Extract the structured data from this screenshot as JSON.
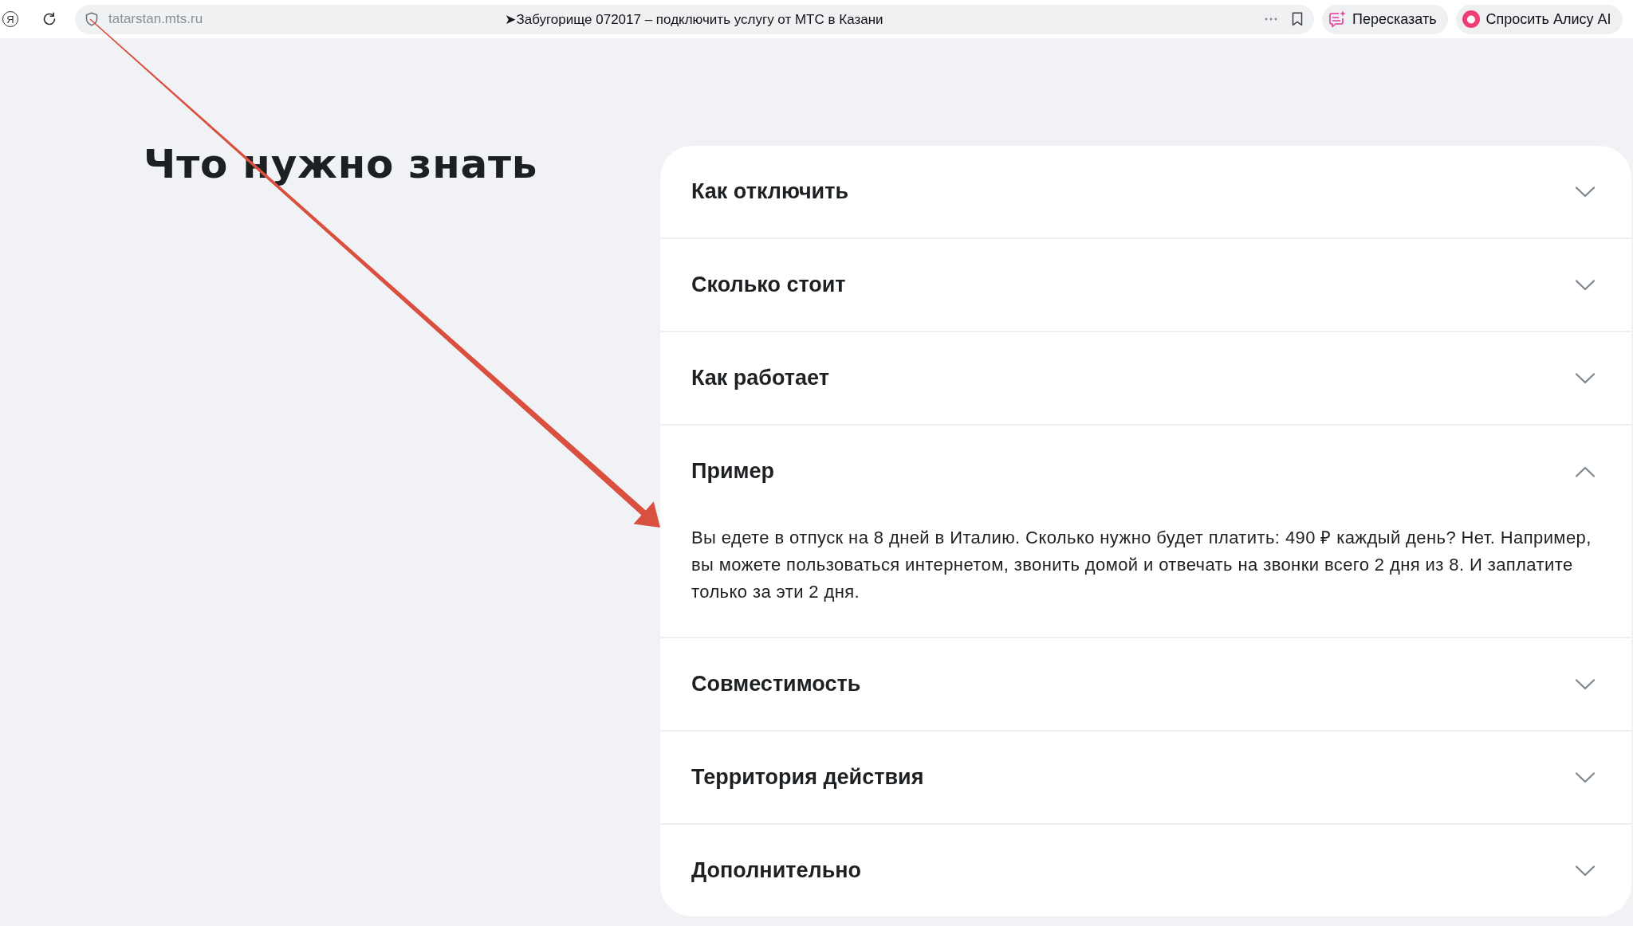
{
  "browser": {
    "logo": "Я",
    "address": "tatarstan.mts.ru",
    "page_title": "➤Забугорище 072017 – подключить услугу от МТС в Казани",
    "buttons": [
      {
        "label": "Пересказать",
        "kind": "retell"
      },
      {
        "label": "Спросить Алису AI",
        "kind": "alice"
      }
    ]
  },
  "section": {
    "heading": "Что нужно знать",
    "faq": [
      {
        "title": "Как отключить",
        "expanded": false
      },
      {
        "title": "Сколько стоит",
        "expanded": false
      },
      {
        "title": "Как работает",
        "expanded": false
      },
      {
        "title": "Пример",
        "expanded": true,
        "body": "Вы едете в отпуск на 8 дней в Италию. Сколько нужно будет платить: 490 ₽ каждый день? Нет. Например, вы можете пользоваться интернетом, звонить домой и отвечать на звонки всего 2 дня из 8. И заплатите только за эти 2 дня."
      },
      {
        "title": "Совместимость",
        "expanded": false
      },
      {
        "title": "Территория действия",
        "expanded": false
      },
      {
        "title": "Дополнительно",
        "expanded": false
      }
    ]
  }
}
